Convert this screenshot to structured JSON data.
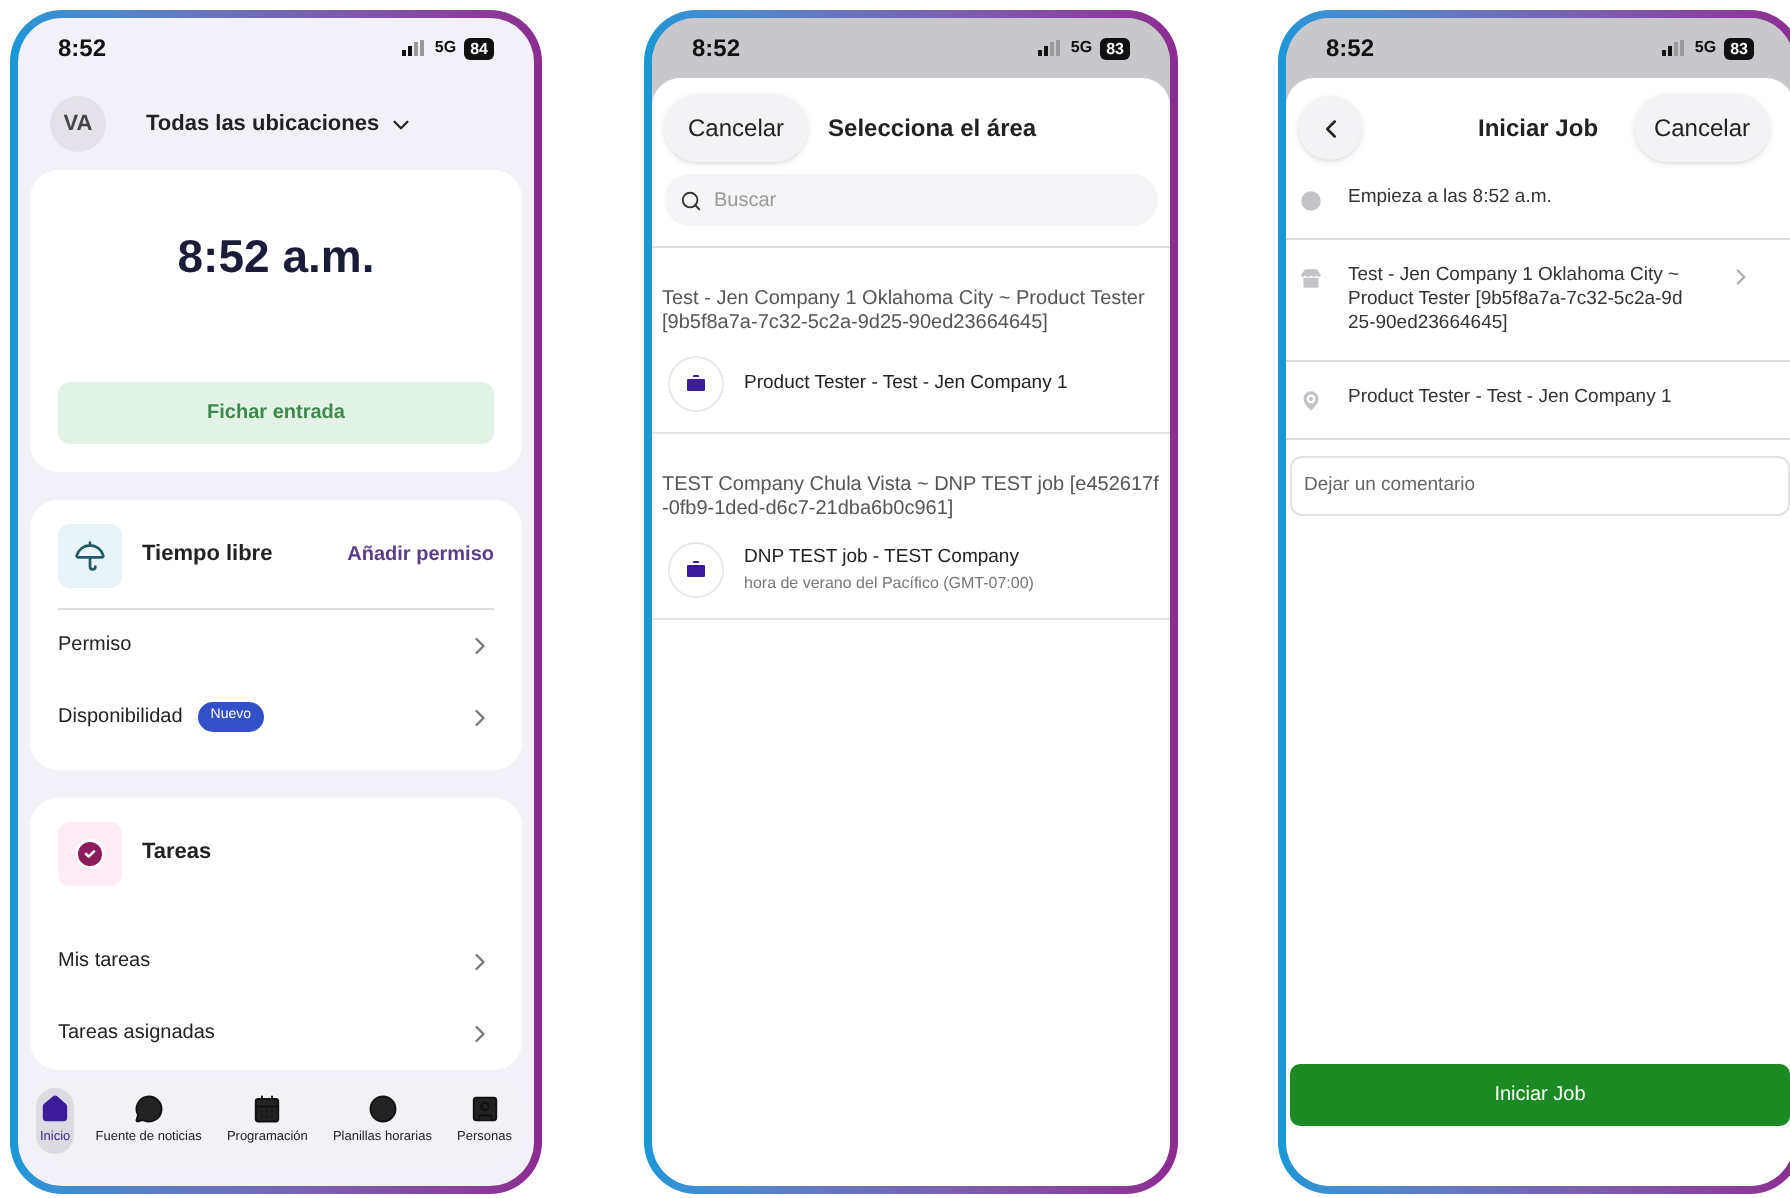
{
  "phones": [
    {
      "kind": "home",
      "status": {
        "time": "8:52",
        "network": "5G",
        "battery": "84"
      },
      "header": {
        "avatar": "VA",
        "location": "Todas las ubicaciones"
      },
      "clock": {
        "time": "8:52 a.m.",
        "button": "Fichar entrada"
      },
      "time_off": {
        "title": "Tiempo libre",
        "action": "Añadir permiso",
        "items": [
          {
            "label": "Permiso"
          },
          {
            "label": "Disponibilidad",
            "badge": "Nuevo"
          }
        ]
      },
      "tasks": {
        "title": "Tareas",
        "items": [
          {
            "label": "Mis tareas"
          },
          {
            "label": "Tareas asignadas"
          }
        ]
      },
      "nav": [
        {
          "label": "Inicio",
          "selected": true
        },
        {
          "label": "Fuente de noticias",
          "selected": false
        },
        {
          "label": "Programación",
          "selected": false
        },
        {
          "label": "Planillas horarias",
          "selected": false
        },
        {
          "label": "Personas",
          "selected": false
        }
      ]
    },
    {
      "kind": "select_area",
      "status": {
        "time": "8:52",
        "network": "5G",
        "battery": "83"
      },
      "cancel": "Cancelar",
      "title": "Selecciona el área",
      "search": {
        "placeholder": "Buscar"
      },
      "groups": [
        {
          "heading": "Test - Jen Company 1 Oklahoma City ~ Product Tester [9b5f8a7a-7c32-5c2a-9d25-90ed23664645]",
          "items": [
            {
              "title": "Product Tester - Test - Jen Company 1"
            }
          ]
        },
        {
          "heading": "TEST Company Chula Vista ~ DNP TEST job [e452617f-0fb9-1ded-d6c7-21dba6b0c961]",
          "items": [
            {
              "title": "DNP TEST job - TEST Company",
              "subtitle": "hora de verano del Pacífico (GMT-07:00)"
            }
          ]
        }
      ]
    },
    {
      "kind": "start_job",
      "status": {
        "time": "8:52",
        "network": "5G",
        "battery": "83"
      },
      "title": "Iniciar Job",
      "cancel": "Cancelar",
      "rows": [
        {
          "kind": "time",
          "text": "Empieza a las 8:52 a.m."
        },
        {
          "kind": "store",
          "text": "Test - Jen Company 1 Oklahoma City ~ Product Tester [9b5f8a7a-7c32-5c2a-9d25-90ed23664645]",
          "chevron": true
        },
        {
          "kind": "location",
          "text": "Product Tester - Test - Jen Company 1"
        }
      ],
      "comment": {
        "placeholder": "Dejar un comentario"
      },
      "button": "Iniciar Job"
    }
  ]
}
